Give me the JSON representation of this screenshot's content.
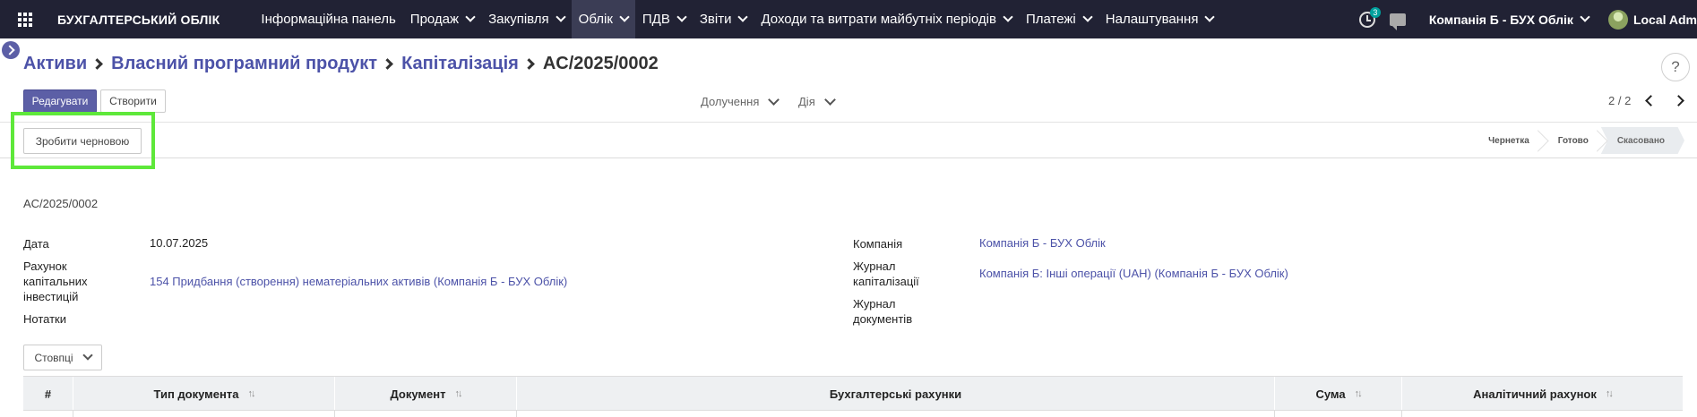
{
  "navbar": {
    "brand": "БУХГАЛТЕРСЬКИЙ ОБЛІК",
    "menu": [
      {
        "label": "Інформаційна панель",
        "dropdown": false
      },
      {
        "label": "Продаж",
        "dropdown": true
      },
      {
        "label": "Закупівля",
        "dropdown": true
      },
      {
        "label": "Облік",
        "dropdown": true,
        "active": true
      },
      {
        "label": "ПДВ",
        "dropdown": true
      },
      {
        "label": "Звіти",
        "dropdown": true
      },
      {
        "label": "Доходи та витрати майбутніх періодів",
        "dropdown": true
      },
      {
        "label": "Платежі",
        "dropdown": true
      },
      {
        "label": "Налаштування",
        "dropdown": true
      }
    ],
    "activity_count": "3",
    "company": "Компанія Б - БУХ Облік",
    "user": "Local Adm"
  },
  "breadcrumb": {
    "items": [
      "Активи",
      "Власний програмний продукт",
      "Капіталізація"
    ],
    "current": "AC/2025/0002"
  },
  "buttons": {
    "edit": "Редагувати",
    "create": "Створити",
    "make_draft": "Зробити черновою",
    "columns": "Стовпці",
    "help": "?"
  },
  "dropdowns": {
    "attachments": "Долучення",
    "action": "Дія"
  },
  "pager": {
    "value": "2 / 2"
  },
  "statusbar": {
    "stages": [
      {
        "label": "Чернетка",
        "active": false
      },
      {
        "label": "Готово",
        "active": false
      },
      {
        "label": "Скасовано",
        "active": true
      }
    ]
  },
  "form": {
    "name": "AC/2025/0002",
    "date_label": "Дата",
    "date_value": "10.07.2025",
    "account_label": "Рахунок капітальних інвестицій",
    "account_value": "154 Придбання (створення) нематеріальних активів (Компанія Б - БУХ Облік)",
    "notes_label": "Нотатки",
    "company_label": "Компанія",
    "company_value": "Компанія Б - БУХ Облік",
    "journal_label": "Журнал капіталізації",
    "journal_value": "Компанія Б: Інші операції (UAH) (Компанія Б - БУХ Облік)",
    "doc_journal_label": "Журнал документів"
  },
  "table": {
    "columns": [
      {
        "label": "#",
        "sortable": false
      },
      {
        "label": "Тип документа",
        "sortable": true
      },
      {
        "label": "Документ",
        "sortable": true
      },
      {
        "label": "Бухгалтерські рахунки",
        "sortable": false
      },
      {
        "label": "Сума",
        "sortable": true
      },
      {
        "label": "Аналітичний рахунок",
        "sortable": true
      }
    ]
  },
  "colors": {
    "navbar": "#212234",
    "primary": "#5c5fa6",
    "link": "#4c52a8",
    "highlight": "#5ee83a"
  }
}
